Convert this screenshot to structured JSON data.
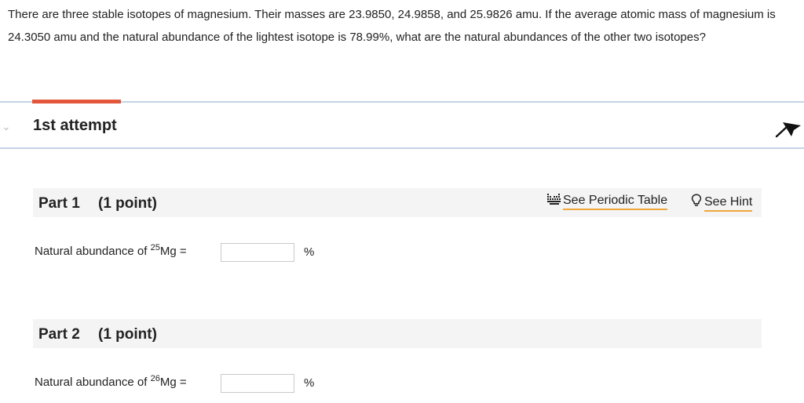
{
  "question": {
    "text": "There are three stable isotopes of magnesium. Their masses are 23.9850, 24.9858, and 25.9826 amu. If the average atomic mass of magnesium is 24.3050 amu and the natural abundance of the lightest isotope is 78.99%, what are the natural abundances of the other two isotopes?"
  },
  "attempt": {
    "title": "1st attempt"
  },
  "tools": {
    "periodic_table": "See Periodic Table",
    "hint": "See Hint"
  },
  "parts": [
    {
      "title": "Part 1",
      "points": "(1 point)",
      "label_prefix": "Natural abundance of ",
      "mass_number": "25",
      "element": "Mg =",
      "value": "",
      "unit": "%"
    },
    {
      "title": "Part 2",
      "points": "(1 point)",
      "label_prefix": "Natural abundance of ",
      "mass_number": "26",
      "element": "Mg =",
      "value": "",
      "unit": "%"
    }
  ],
  "colors": {
    "accent": "#e2563c",
    "divider": "#c6d3e6",
    "link_underline": "#f0a63a",
    "part_band": "#f4f4f4"
  }
}
